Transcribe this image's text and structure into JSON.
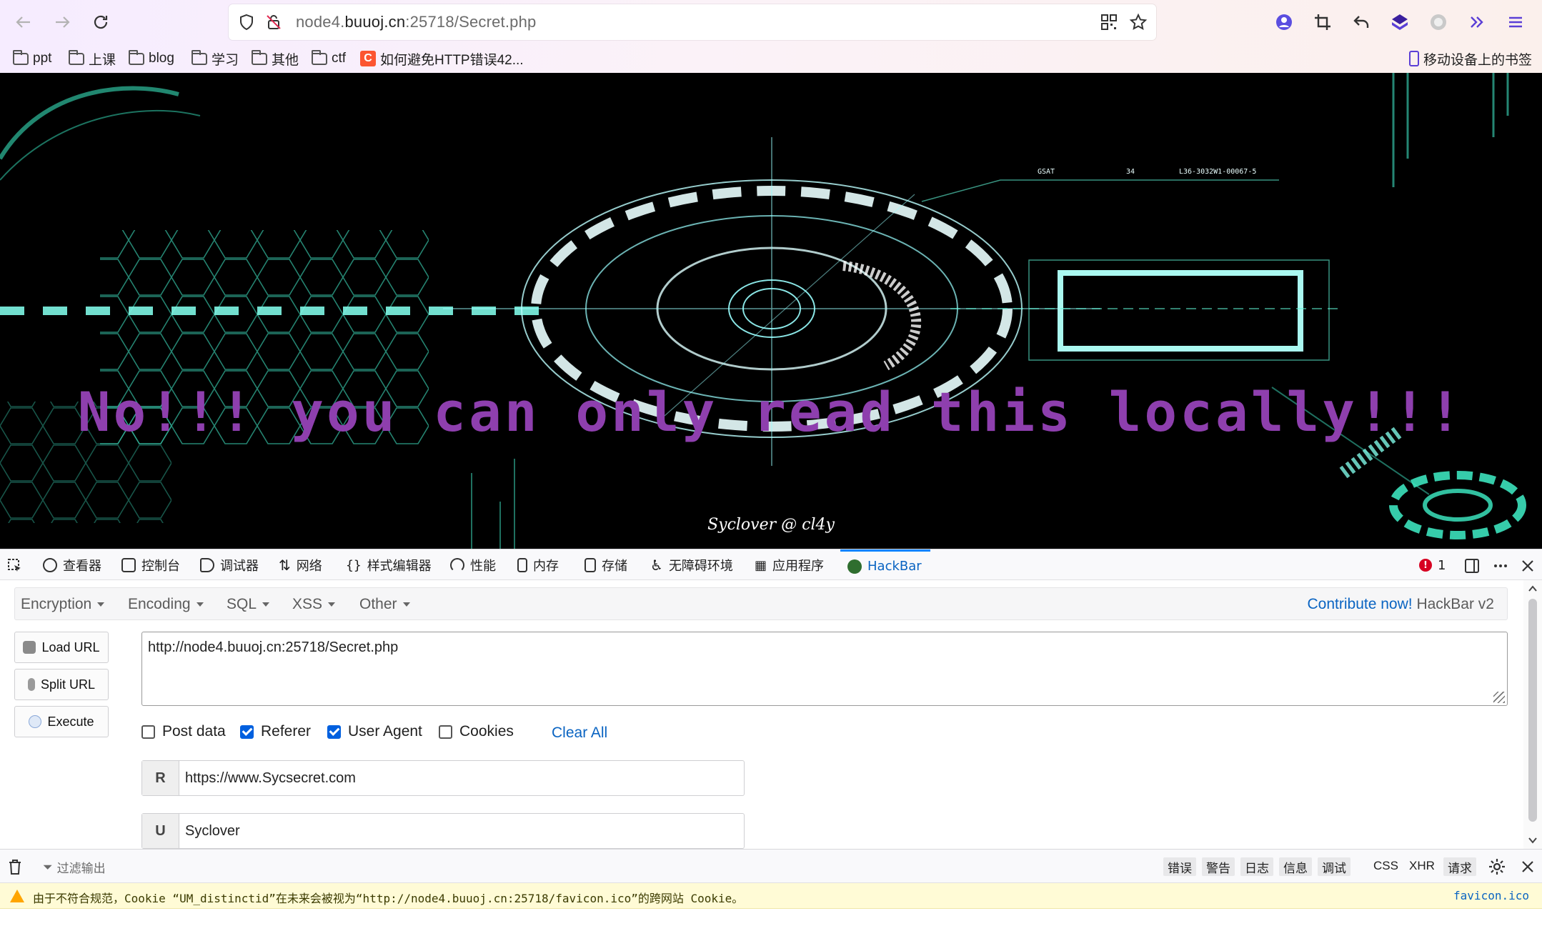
{
  "browser": {
    "url_prefix": "node4.",
    "url_host": "buuoj.cn",
    "url_rest": ":25718/Secret.php"
  },
  "bookmarks": {
    "items": [
      {
        "label": "ppt"
      },
      {
        "label": "上课"
      },
      {
        "label": "blog"
      },
      {
        "label": "学习"
      },
      {
        "label": "其他"
      },
      {
        "label": "ctf"
      },
      {
        "label": "如何避免HTTP错误42..."
      }
    ],
    "mobile": "移动设备上的书签"
  },
  "page": {
    "headline": "No!!! you can only read this locally!!!",
    "signature": "Syclover @ cl4y",
    "hud_text_1": "GSAT",
    "hud_text_2": "34",
    "hud_text_3": "L36-3032W1-00067-5"
  },
  "devtools": {
    "tabs": [
      {
        "label": "查看器"
      },
      {
        "label": "控制台"
      },
      {
        "label": "调试器"
      },
      {
        "label": "网络"
      },
      {
        "label": "样式编辑器"
      },
      {
        "label": "性能"
      },
      {
        "label": "内存"
      },
      {
        "label": "存储"
      },
      {
        "label": "无障碍环境"
      },
      {
        "label": "应用程序"
      },
      {
        "label": "HackBar"
      }
    ],
    "error_count": "1"
  },
  "hackbar": {
    "menu": [
      "Encryption",
      "Encoding",
      "SQL",
      "XSS",
      "Other"
    ],
    "contribute": "Contribute now!",
    "version": "HackBar v2",
    "buttons": {
      "load": "Load URL",
      "split": "Split URL",
      "execute": "Execute"
    },
    "url_value": "http://node4.buuoj.cn:25718/Secret.php",
    "options": [
      {
        "label": "Post data",
        "checked": false
      },
      {
        "label": "Referer",
        "checked": true
      },
      {
        "label": "User Agent",
        "checked": true
      },
      {
        "label": "Cookies",
        "checked": false
      }
    ],
    "clear_all": "Clear All",
    "referer_tag": "R",
    "referer_value": "https://www.Sycsecret.com",
    "ua_tag": "U",
    "ua_value": "Syclover"
  },
  "console": {
    "filter_placeholder": "过滤输出",
    "filters": [
      "错误",
      "警告",
      "日志",
      "信息",
      "调试"
    ],
    "filters_plain": [
      "CSS",
      "XHR",
      "请求"
    ],
    "warning": "由于不符合规范，Cookie “UM_distinctid”在未来会被视为“http://node4.buuoj.cn:25718/favicon.ico”的跨网站 Cookie。",
    "warning_source": "favicon.ico"
  },
  "colors": {
    "accent": "#0a64c2",
    "headline": "#8e3fae",
    "hud": "#5ff5d6"
  }
}
